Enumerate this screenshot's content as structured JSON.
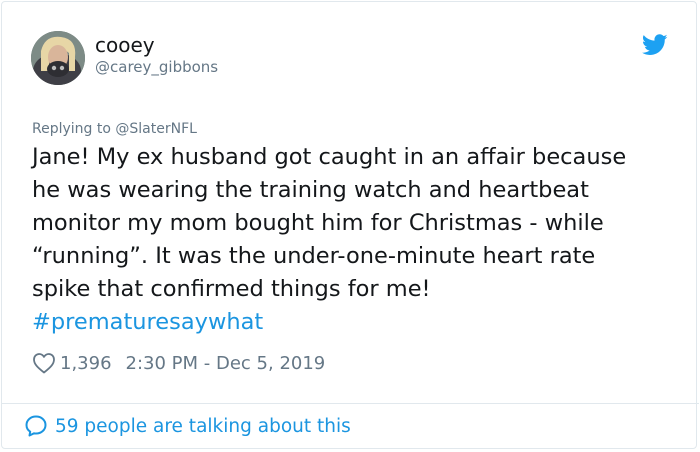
{
  "author": {
    "display_name": "cooey",
    "handle": "@carey_gibbons",
    "avatar_icon": "profile-photo"
  },
  "reply": {
    "prefix": "Replying to",
    "mention": "@SlaterNFL"
  },
  "tweet": {
    "text": "Jane! My ex husband got caught in an affair because\nhe was wearing the training watch and heartbeat\nmonitor my mom bought him for Christmas - while\n“running”. It was the under-one-minute heart rate\nspike that confirmed things for me!",
    "hashtag": "#prematuresaywhat"
  },
  "meta": {
    "likes": "1,396",
    "timestamp": "2:30 PM - Dec 5, 2019"
  },
  "footer": {
    "talking_text": "59 people are talking about this"
  },
  "icons": {
    "brand": "twitter-bird-icon",
    "like": "heart-icon",
    "conversation": "speech-bubble-icon"
  },
  "colors": {
    "twitter_blue": "#1da1f2",
    "link_blue": "#1b95e0",
    "secondary_text": "#657786",
    "primary_text": "#14171a",
    "border": "#e1e8ed"
  }
}
